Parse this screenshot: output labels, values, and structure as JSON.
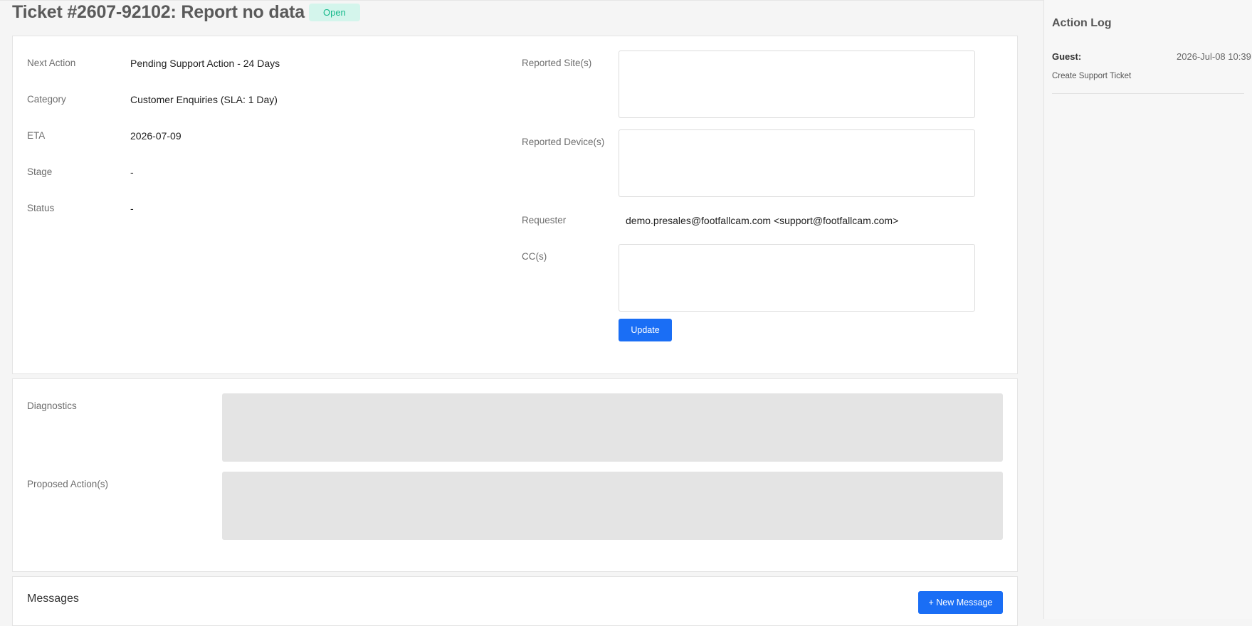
{
  "ticket": {
    "title": "Ticket #2607-92102: Report no data",
    "status": "Open"
  },
  "details": {
    "next_action": {
      "label": "Next Action",
      "value": "Pending Support Action - 24 Days"
    },
    "category": {
      "label": "Category",
      "value": "Customer Enquiries (SLA: 1 Day)"
    },
    "eta": {
      "label": "ETA",
      "value": "2026-07-09"
    },
    "stage": {
      "label": "Stage",
      "value": "-"
    },
    "status": {
      "label": "Status",
      "value": "-"
    },
    "reported_sites": {
      "label": "Reported Site(s)",
      "value": ""
    },
    "reported_devices": {
      "label": "Reported Device(s)",
      "value": ""
    },
    "requester": {
      "label": "Requester",
      "value": "demo.presales@footfallcam.com <support@footfallcam.com>"
    },
    "ccs": {
      "label": "CC(s)",
      "value": ""
    },
    "update_label": "Update"
  },
  "diagnostics": {
    "diagnostics_label": "Diagnostics",
    "proposed_label": "Proposed Action(s)"
  },
  "messages": {
    "title": "Messages",
    "new_message_label": "+ New Message"
  },
  "action_log": {
    "title": "Action Log",
    "entries": [
      {
        "actor": "Guest:",
        "time": "2026-Jul-08 10:39",
        "action": "Create Support Ticket"
      }
    ]
  },
  "colors": {
    "accent": "#1a6ef5",
    "status_badge_bg": "#d4f5ec",
    "status_badge_text": "#14b88a"
  }
}
